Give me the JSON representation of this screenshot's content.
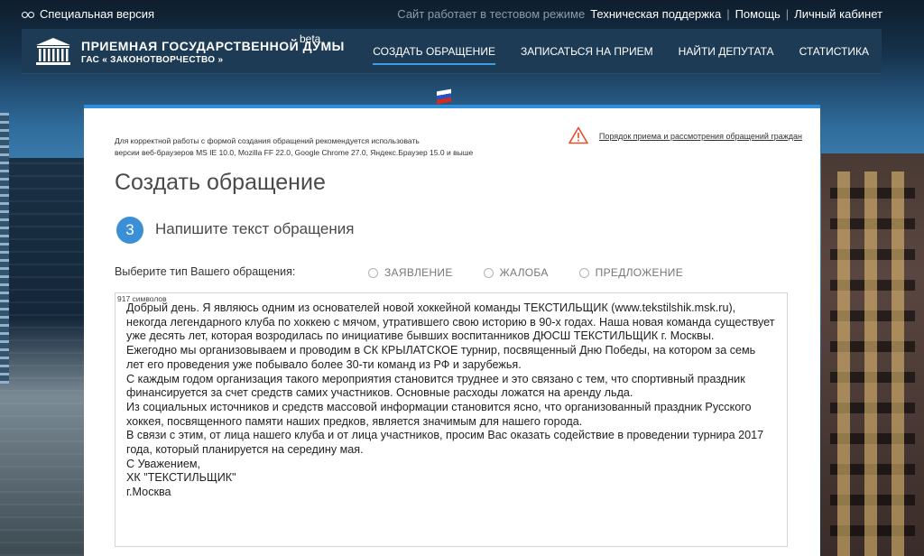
{
  "topbar": {
    "special_version": "Специальная версия",
    "test_mode": "Сайт работает в тестовом режиме",
    "links": [
      "Техническая поддержка",
      "Помощь",
      "Личный кабинет"
    ]
  },
  "header": {
    "title": "ПРИЕМНАЯ ГОСУДАРСТВЕННОЙ ДУМЫ",
    "beta": "beta",
    "subtitle": "ГАС « ЗАКОНОТВОРЧЕСТВО »",
    "nav": [
      {
        "label": "СОЗДАТЬ ОБРАЩЕНИЕ",
        "active": true
      },
      {
        "label": "ЗАПИСАТЬСЯ НА ПРИЕМ",
        "active": false
      },
      {
        "label": "НАЙТИ ДЕПУТАТА",
        "active": false
      },
      {
        "label": "СТАТИСТИКА",
        "active": false
      }
    ]
  },
  "card": {
    "notice_line1": "Для корректной работы с формой создания обращений рекомендуется использовать",
    "notice_line2": "версии веб-браузеров MS IE 10.0, Mozilla FF 22.0, Google Chrome 27.0, Яндекс.Браузер 15.0 и выше",
    "procedure_link": "Порядок приема и рассмотрения обращений граждан",
    "page_title": "Создать обращение",
    "step_number": "3",
    "step_title": "Напишите текст обращения",
    "type_label": "Выберите тип Вашего обращения:",
    "types": [
      "ЗАЯВЛЕНИЕ",
      "ЖАЛОБА",
      "ПРЕДЛОЖЕНИЕ"
    ],
    "char_count": "917 символов",
    "message": "Добрый день. Я являюсь одним из основателей новой хоккейной команды ТЕКСТИЛЬЩИК (www.tekstilshik.msk.ru), некогда легендарного клуба по хоккею с мячом, утратившего свою историю в 90-х годах. Наша новая команда существует уже десять лет, которая возродилась по инициативе бывших воспитанников ДЮСШ ТЕКСТИЛЬЩИК г. Москвы.\nЕжегодно мы организовываем и проводим в СК КРЫЛАТСКОЕ турнир, посвященный Дню Победы, на котором за семь лет его проведения уже побывало более 30-ти команд из РФ и зарубежья.\nС каждым годом организация такого мероприятия становится труднее и это связано с тем, что спортивный праздник финансируется за счет средств самих участников. Основные расходы ложатся на аренду льда.\nИз социальных источников и средств массовой информации становится ясно, что организованный праздник Русского хоккея, посвященного памяти наших предков, является значимым для нашего города.\nВ связи с этим, от лица нашего клуба и от лица участников, просим Вас оказать содействие в проведении турнира 2017 года, который планируется на середину мая.\nС Уважением,\nХК \"ТЕКСТИЛЬЩИК\"\nг.Москва"
  },
  "colors": {
    "accent": "#3a8fd6",
    "header_bg": "#1d3b55",
    "nav_underline": "#3aa2e4",
    "warning": "#e0502a"
  },
  "icons": [
    "glasses-icon",
    "duma-building-logo",
    "warning-triangle-icon"
  ]
}
